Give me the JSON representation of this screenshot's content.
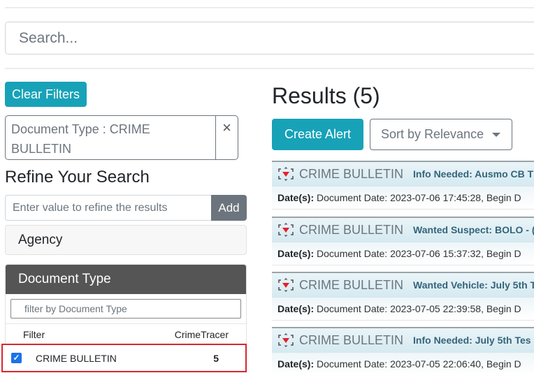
{
  "search": {
    "placeholder": "Search..."
  },
  "filters": {
    "clear_label": "Clear Filters",
    "active_chip": "Document Type : CRIME BULLETIN",
    "remove_icon": "×"
  },
  "refine": {
    "title": "Refine Your Search",
    "input_placeholder": "Enter value to refine the results",
    "add_label": "Add"
  },
  "facets": {
    "agency": {
      "label": "Agency"
    },
    "document_type": {
      "label": "Document Type",
      "filter_placeholder": "filter by Document Type",
      "col_filter": "Filter",
      "col_source": "CrimeTracer",
      "rows": [
        {
          "label": "CRIME BULLETIN",
          "count": "5",
          "checked": true
        }
      ]
    }
  },
  "results": {
    "title": "Results (5)",
    "create_alert_label": "Create Alert",
    "sort_label": "Sort by Relevance",
    "items": [
      {
        "type": "CRIME BULLETIN",
        "title": "Info Needed: Ausmo CB T",
        "date_label": "Date(s):",
        "date_text": "Document Date: 2023-07-06 17:45:28, Begin D"
      },
      {
        "type": "CRIME BULLETIN",
        "title": "Wanted Suspect: BOLO - (",
        "date_label": "Date(s):",
        "date_text": "Document Date: 2023-07-06 15:37:32, Begin D"
      },
      {
        "type": "CRIME BULLETIN",
        "title": "Wanted Vehicle: July 5th T",
        "date_label": "Date(s):",
        "date_text": "Document Date: 2023-07-05 22:39:58, Begin D"
      },
      {
        "type": "CRIME BULLETIN",
        "title": "Info Needed: July 5th Tes",
        "date_label": "Date(s):",
        "date_text": "Document Date: 2023-07-05 22:06:40, Begin D"
      }
    ]
  },
  "colors": {
    "accent": "#17a2b8",
    "secondary": "#6c757d",
    "panel_header": "#555555",
    "highlight_border": "#d9262e",
    "checkbox": "#1a73e8"
  }
}
